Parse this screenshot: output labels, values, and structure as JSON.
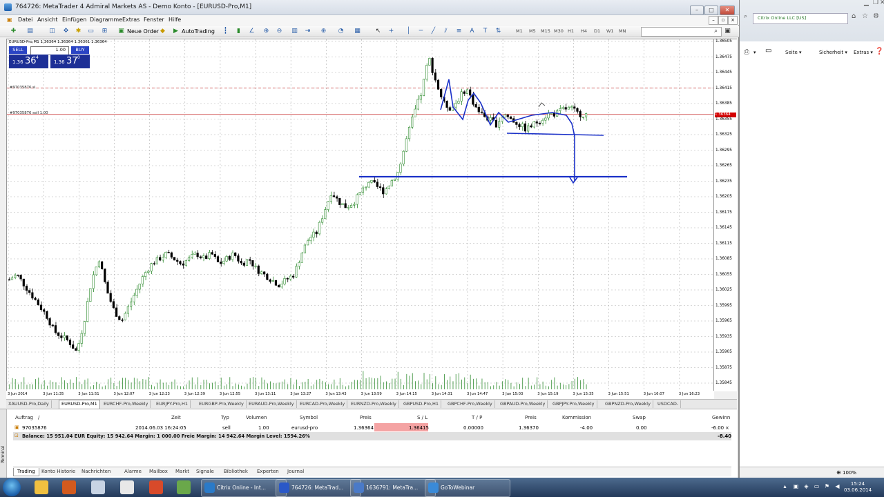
{
  "window": {
    "title": "764726: MetaTrader 4 Admiral Markets AS - Demo Konto - [EURUSD-Pro,M1]",
    "minimize": "–",
    "maximize": "□",
    "close": "✕"
  },
  "menu": [
    "Datei",
    "Ansicht",
    "Einfügen",
    "Diagramme",
    "Extras",
    "Fenster",
    "Hilfe"
  ],
  "toolbar": {
    "new_order": "Neue Order",
    "autotrading": "AutoTrading",
    "timeframes": [
      "M1",
      "M5",
      "M15",
      "M30",
      "H1",
      "H4",
      "D1",
      "W1",
      "MN"
    ]
  },
  "chart": {
    "symbol_line": "EURUSD-Pro,M1  1.36364 1.36364 1.36361 1.36364",
    "one_click": {
      "sell_label": "SELL",
      "buy_label": "BUY",
      "lots": "1.00",
      "sell_big": "36",
      "sell_small": "1.36",
      "sell_frac": "4",
      "buy_big": "37",
      "buy_small": "1.36",
      "buy_frac": "0"
    },
    "sl_label": "#97035876 sl",
    "sell_label": "#97035876 sell 1.00",
    "current_price": "1.36364",
    "colors": {
      "bull": "#2e8b2e",
      "bear": "#000000",
      "annotation": "#1a30c8",
      "sl_line": "#c83232"
    }
  },
  "chart_data": {
    "type": "candlestick",
    "symbol": "EURUSD-Pro",
    "timeframe": "M1",
    "ylim": [
      1.35845,
      1.36505
    ],
    "y_ticks": [
      "1.36505",
      "1.36475",
      "1.36445",
      "1.36415",
      "1.36385",
      "1.36355",
      "1.36325",
      "1.36295",
      "1.36265",
      "1.36235",
      "1.36205",
      "1.36175",
      "1.36145",
      "1.36115",
      "1.36085",
      "1.36055",
      "1.36025",
      "1.35995",
      "1.35965",
      "1.35935",
      "1.35905",
      "1.35875",
      "1.35845"
    ],
    "x_ticks": [
      "3 Jun 2014",
      "3 Jun 11:35",
      "3 Jun 11:51",
      "3 Jun 12:07",
      "3 Jun 12:23",
      "3 Jun 12:39",
      "3 Jun 12:55",
      "3 Jun 13:11",
      "3 Jun 13:27",
      "3 Jun 13:43",
      "3 Jun 13:59",
      "3 Jun 14:15",
      "3 Jun 14:31",
      "3 Jun 14:47",
      "3 Jun 15:03",
      "3 Jun 15:19",
      "3 Jun 15:35",
      "3 Jun 15:51",
      "3 Jun 16:07",
      "3 Jun 16:23"
    ],
    "close_path": [
      1.36045,
      1.36055,
      1.36035,
      1.36015,
      1.35995,
      1.35975,
      1.35945,
      1.35935,
      1.35925,
      1.35905,
      1.35965,
      1.36045,
      1.36085,
      1.36025,
      1.35985,
      1.35965,
      1.35995,
      1.36025,
      1.36055,
      1.36075,
      1.36085,
      1.36095,
      1.36085,
      1.36075,
      1.36085,
      1.36095,
      1.36085,
      1.36095,
      1.36075,
      1.36085,
      1.36095,
      1.36075,
      1.36085,
      1.36065,
      1.36055,
      1.36045,
      1.36035,
      1.36045,
      1.36055,
      1.36095,
      1.36125,
      1.36135,
      1.36175,
      1.36215,
      1.36195,
      1.36185,
      1.36195,
      1.36215,
      1.36235,
      1.36225,
      1.36215,
      1.36235,
      1.36255,
      1.36315,
      1.36365,
      1.36405,
      1.36475,
      1.36425,
      1.36385,
      1.36375,
      1.36395,
      1.36415,
      1.36385,
      1.36365,
      1.36355,
      1.36345,
      1.36365,
      1.36355,
      1.36345,
      1.36335,
      1.36345,
      1.36355,
      1.36365,
      1.36365,
      1.36375,
      1.36375,
      1.36365,
      1.36364
    ],
    "sl_level": 1.36415,
    "entry_level": 1.36364
  },
  "symbol_tabs": [
    "XAUUSD-Pro,Daily",
    "EURUSD-Pro,M1",
    "EURCHF-Pro,Weekly",
    "EURJPY-Pro,H1",
    "EURGBP-Pro,Weekly",
    "EURAUD-Pro,Weekly",
    "EURCAD-Pro,Weekly",
    "EURNZD-Pro,Weekly",
    "GBPUSD-Pro,H1",
    "GBPCHF-Pro,Weekly",
    "GBPAUD-Pro,Weekly",
    "GBPJPY-Pro,Weekly",
    "GBPNZD-Pro,Weekly",
    "USDCAD-"
  ],
  "terminal": {
    "side_label": "Terminal",
    "columns": [
      "Auftrag",
      "/",
      "Zeit",
      "Typ",
      "Volumen",
      "Symbol",
      "Preis",
      "S / L",
      "T / P",
      "Preis",
      "Kommission",
      "Swap",
      "Gewinn"
    ],
    "row": {
      "order": "97035876",
      "time": "2014.06.03 16:24:05",
      "type": "sell",
      "volume": "1.00",
      "symbol": "eurusd-pro",
      "price": "1.36364",
      "sl": "1.36415",
      "tp": "0.00000",
      "price_now": "1.36370",
      "commission": "-4.00",
      "swap": "0.00",
      "profit": "-6.00"
    },
    "balance": "Balance: 15 951.04 EUR  Equity: 15 942.64  Margin: 1 000.00  Freie Margin: 14 942.64  Margin Level: 1594.26%",
    "balance_profit": "-8.40",
    "tabs": [
      "Trading",
      "Konto Historie",
      "Nachrichten",
      "Alarme",
      "Mailbox",
      "Markt",
      "Signale",
      "Bibliothek",
      "Experten",
      "Journal"
    ]
  },
  "browser": {
    "address": "Citrix Online LLC [US]",
    "commands": [
      "Seite ▾",
      "Sicherheit ▾",
      "Extras ▾"
    ],
    "zoom": "100%"
  },
  "taskbar": {
    "tasks": [
      "Citrix Online - Int...",
      "764726: MetaTrad...",
      "1636791: MetaTra...",
      "GoToWebinar"
    ],
    "time": "15:24",
    "date": "03.06.2014"
  }
}
